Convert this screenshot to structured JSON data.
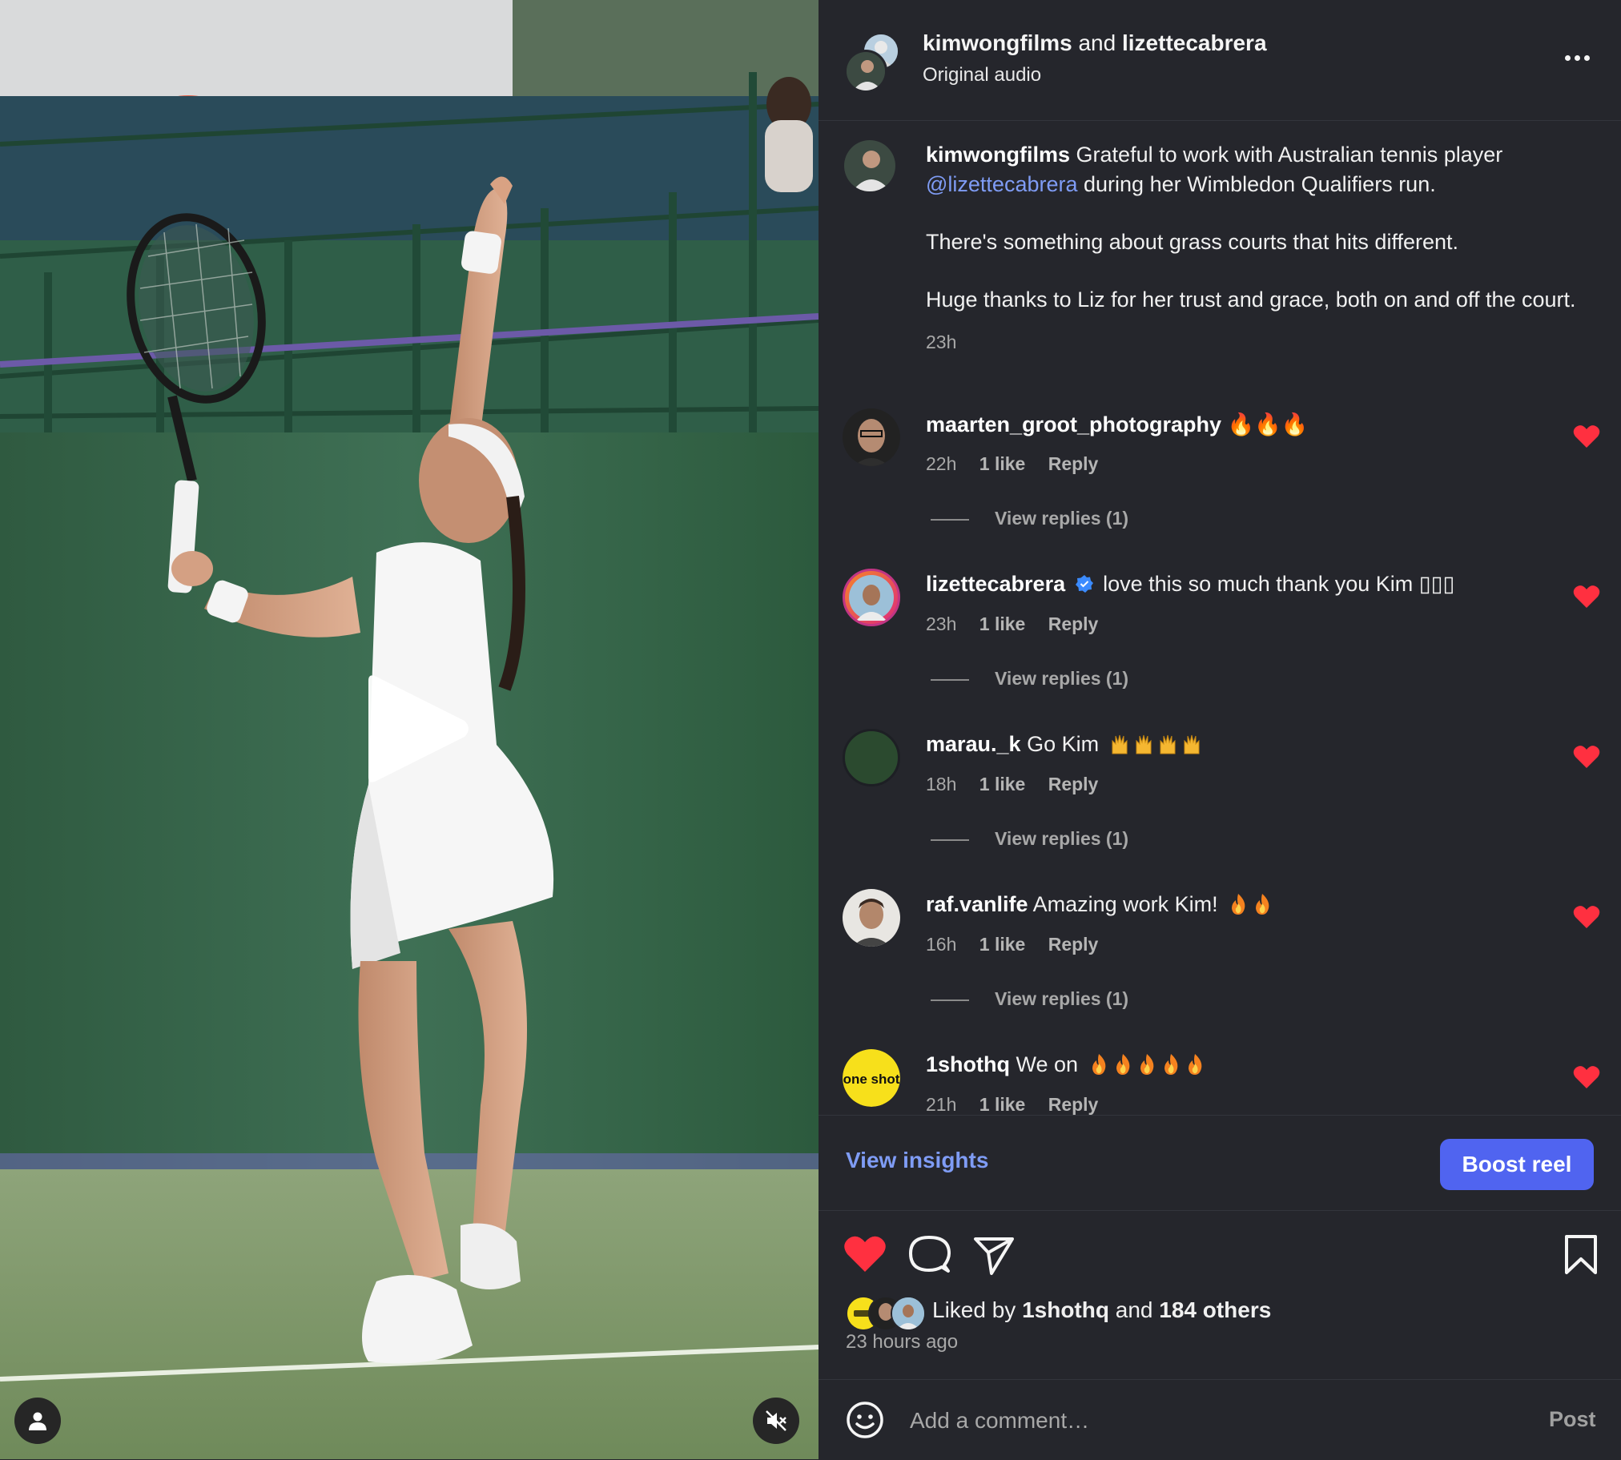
{
  "colors": {
    "panel_bg": "#25262c",
    "accent_blue": "#7f9cf5",
    "boost_bg": "#5064f0",
    "like_red": "#ff3040",
    "muted_text": "#a8a8a8"
  },
  "media": {
    "play_icon": "play-icon",
    "tag_icon": "user-tag-icon",
    "mute_icon": "muted-speaker-icon"
  },
  "header": {
    "user1": "kimwongfilms",
    "joiner": "and",
    "user2": "lizettecabrera",
    "audio": "Original audio",
    "more_icon": "more-horizontal-icon"
  },
  "caption": {
    "user": "kimwongfilms",
    "text1": "Grateful to work with Australian tennis player",
    "mention": "@lizettecabrera",
    "text2": "during her Wimbledon Qualifiers run.",
    "para2": "There's something about grass courts that hits different.",
    "para3": "Huge thanks to Liz for her trust and grace, both on and off the court.",
    "time": "23h"
  },
  "comments": [
    {
      "user": "maarten_groot_photography",
      "text": "🔥🔥🔥",
      "time": "22h",
      "likes": "1 like",
      "reply": "Reply",
      "view_replies": "View replies (1)",
      "verified": false,
      "emoji": "fire",
      "emoji_count": 3
    },
    {
      "user": "lizettecabrera",
      "text": "love this so much thank you Kim ▯▯▯",
      "time": "23h",
      "likes": "1 like",
      "reply": "Reply",
      "view_replies": "View replies (1)",
      "verified": true,
      "emoji": "",
      "emoji_count": 0
    },
    {
      "user": "marau._k",
      "text": "Go Kim",
      "time": "18h",
      "likes": "1 like",
      "reply": "Reply",
      "view_replies": "View replies (1)",
      "verified": false,
      "emoji": "raised-hands",
      "emoji_count": 4
    },
    {
      "user": "raf.vanlife",
      "text": "Amazing work Kim!",
      "time": "16h",
      "likes": "1 like",
      "reply": "Reply",
      "view_replies": "View replies (1)",
      "verified": false,
      "emoji": "fire",
      "emoji_count": 2
    },
    {
      "user": "1shothq",
      "text": "We on",
      "time": "21h",
      "likes": "1 like",
      "reply": "Reply",
      "view_replies": "",
      "verified": false,
      "emoji": "fire",
      "emoji_count": 5
    }
  ],
  "insights": {
    "view_label": "View insights",
    "boost_label": "Boost reel"
  },
  "actions": {
    "like_icon": "heart-filled-icon",
    "comment_icon": "comment-icon",
    "share_icon": "send-icon",
    "save_icon": "bookmark-icon"
  },
  "likes": {
    "prefix": "Liked by",
    "user": "1shothq",
    "joiner": "and",
    "others": "184 others"
  },
  "posted": "23 hours ago",
  "compose": {
    "placeholder": "Add a comment…",
    "post_label": "Post",
    "emoji_icon": "smiley-icon"
  },
  "avatar_text": {
    "oneshot": "one shot"
  }
}
